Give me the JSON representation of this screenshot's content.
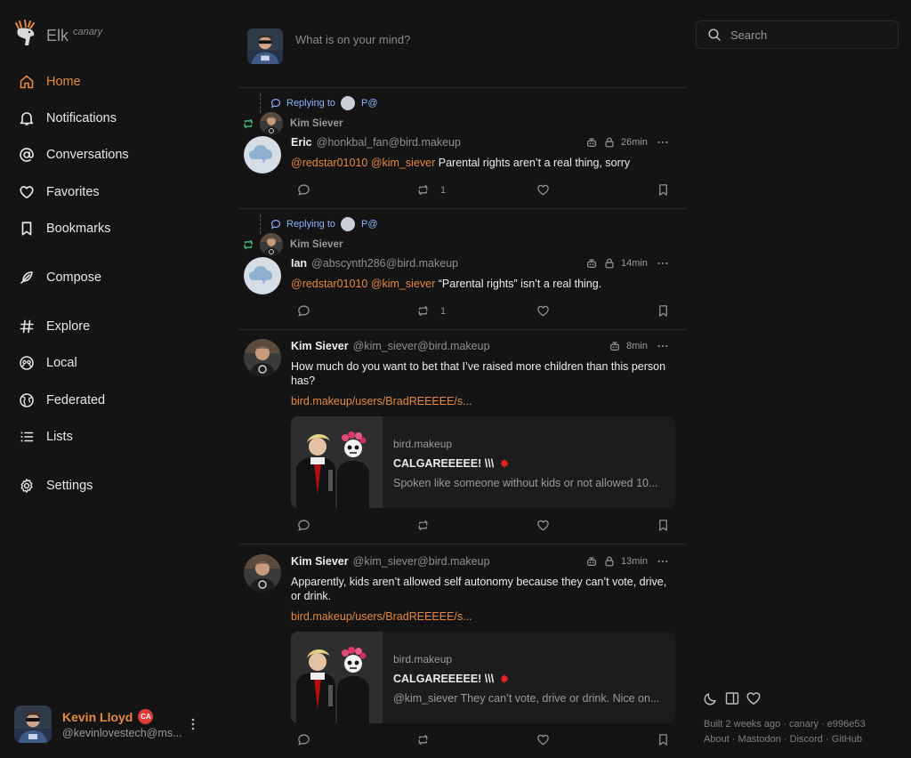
{
  "app": {
    "name": "Elk",
    "tag": "canary"
  },
  "nav": {
    "home": "Home",
    "notifications": "Notifications",
    "conversations": "Conversations",
    "favorites": "Favorites",
    "bookmarks": "Bookmarks",
    "compose": "Compose",
    "explore": "Explore",
    "local": "Local",
    "federated": "Federated",
    "lists": "Lists",
    "settings": "Settings"
  },
  "account": {
    "display_name": "Kevin Lloyd",
    "badge": "CA",
    "handle": "@kevinlovestech@ms..."
  },
  "composer": {
    "placeholder": "What is on your mind?"
  },
  "search": {
    "placeholder": "Search"
  },
  "colors": {
    "accent": "#e5893f",
    "reply_blue": "#8cb4ff",
    "background": "#141414"
  },
  "statuses": [
    {
      "replying_label": "Replying to",
      "replying_target": "P@",
      "boosted_by": "Kim Siever",
      "name": "Eric",
      "handle": "@honkbal_fan@bird.makeup",
      "time": "26min",
      "mention1": "@redstar01010",
      "mention2": "@kim_siever",
      "text": "Parental rights aren’t a real thing, sorry",
      "boosts": "1"
    },
    {
      "replying_label": "Replying to",
      "replying_target": "P@",
      "boosted_by": "Kim Siever",
      "name": "Ian",
      "handle": "@abscynth286@bird.makeup",
      "time": "14min",
      "mention1": "@redstar01010",
      "mention2": "@kim_siever",
      "text": "“Parental rights” isn’t a real thing.",
      "boosts": "1"
    },
    {
      "name": "Kim Siever",
      "handle": "@kim_siever@bird.makeup",
      "time": "8min",
      "text": "How much do you want to bet that I’ve raised more children than this person has?",
      "link": "bird.makeup/users/BradREEEEE/s...",
      "card": {
        "source": "bird.makeup",
        "title": "CALGAREEEEE! \\\\\\",
        "description": "Spoken like someone without kids or not allowed 10..."
      }
    },
    {
      "name": "Kim Siever",
      "handle": "@kim_siever@bird.makeup",
      "time": "13min",
      "text": "Apparently, kids aren’t allowed self autonomy because they can’t vote, drive, or drink.",
      "link": "bird.makeup/users/BradREEEEE/s...",
      "card": {
        "source": "bird.makeup",
        "title": "CALGAREEEEE! \\\\\\",
        "description": "@kim_siever They can’t vote, drive or drink. Nice on..."
      }
    }
  ],
  "footer": {
    "built": "Built 2 weeks ago · canary · e996e53",
    "about": "About",
    "mastodon": "Mastodon",
    "discord": "Discord",
    "github": "GitHub",
    "sep": " · "
  }
}
